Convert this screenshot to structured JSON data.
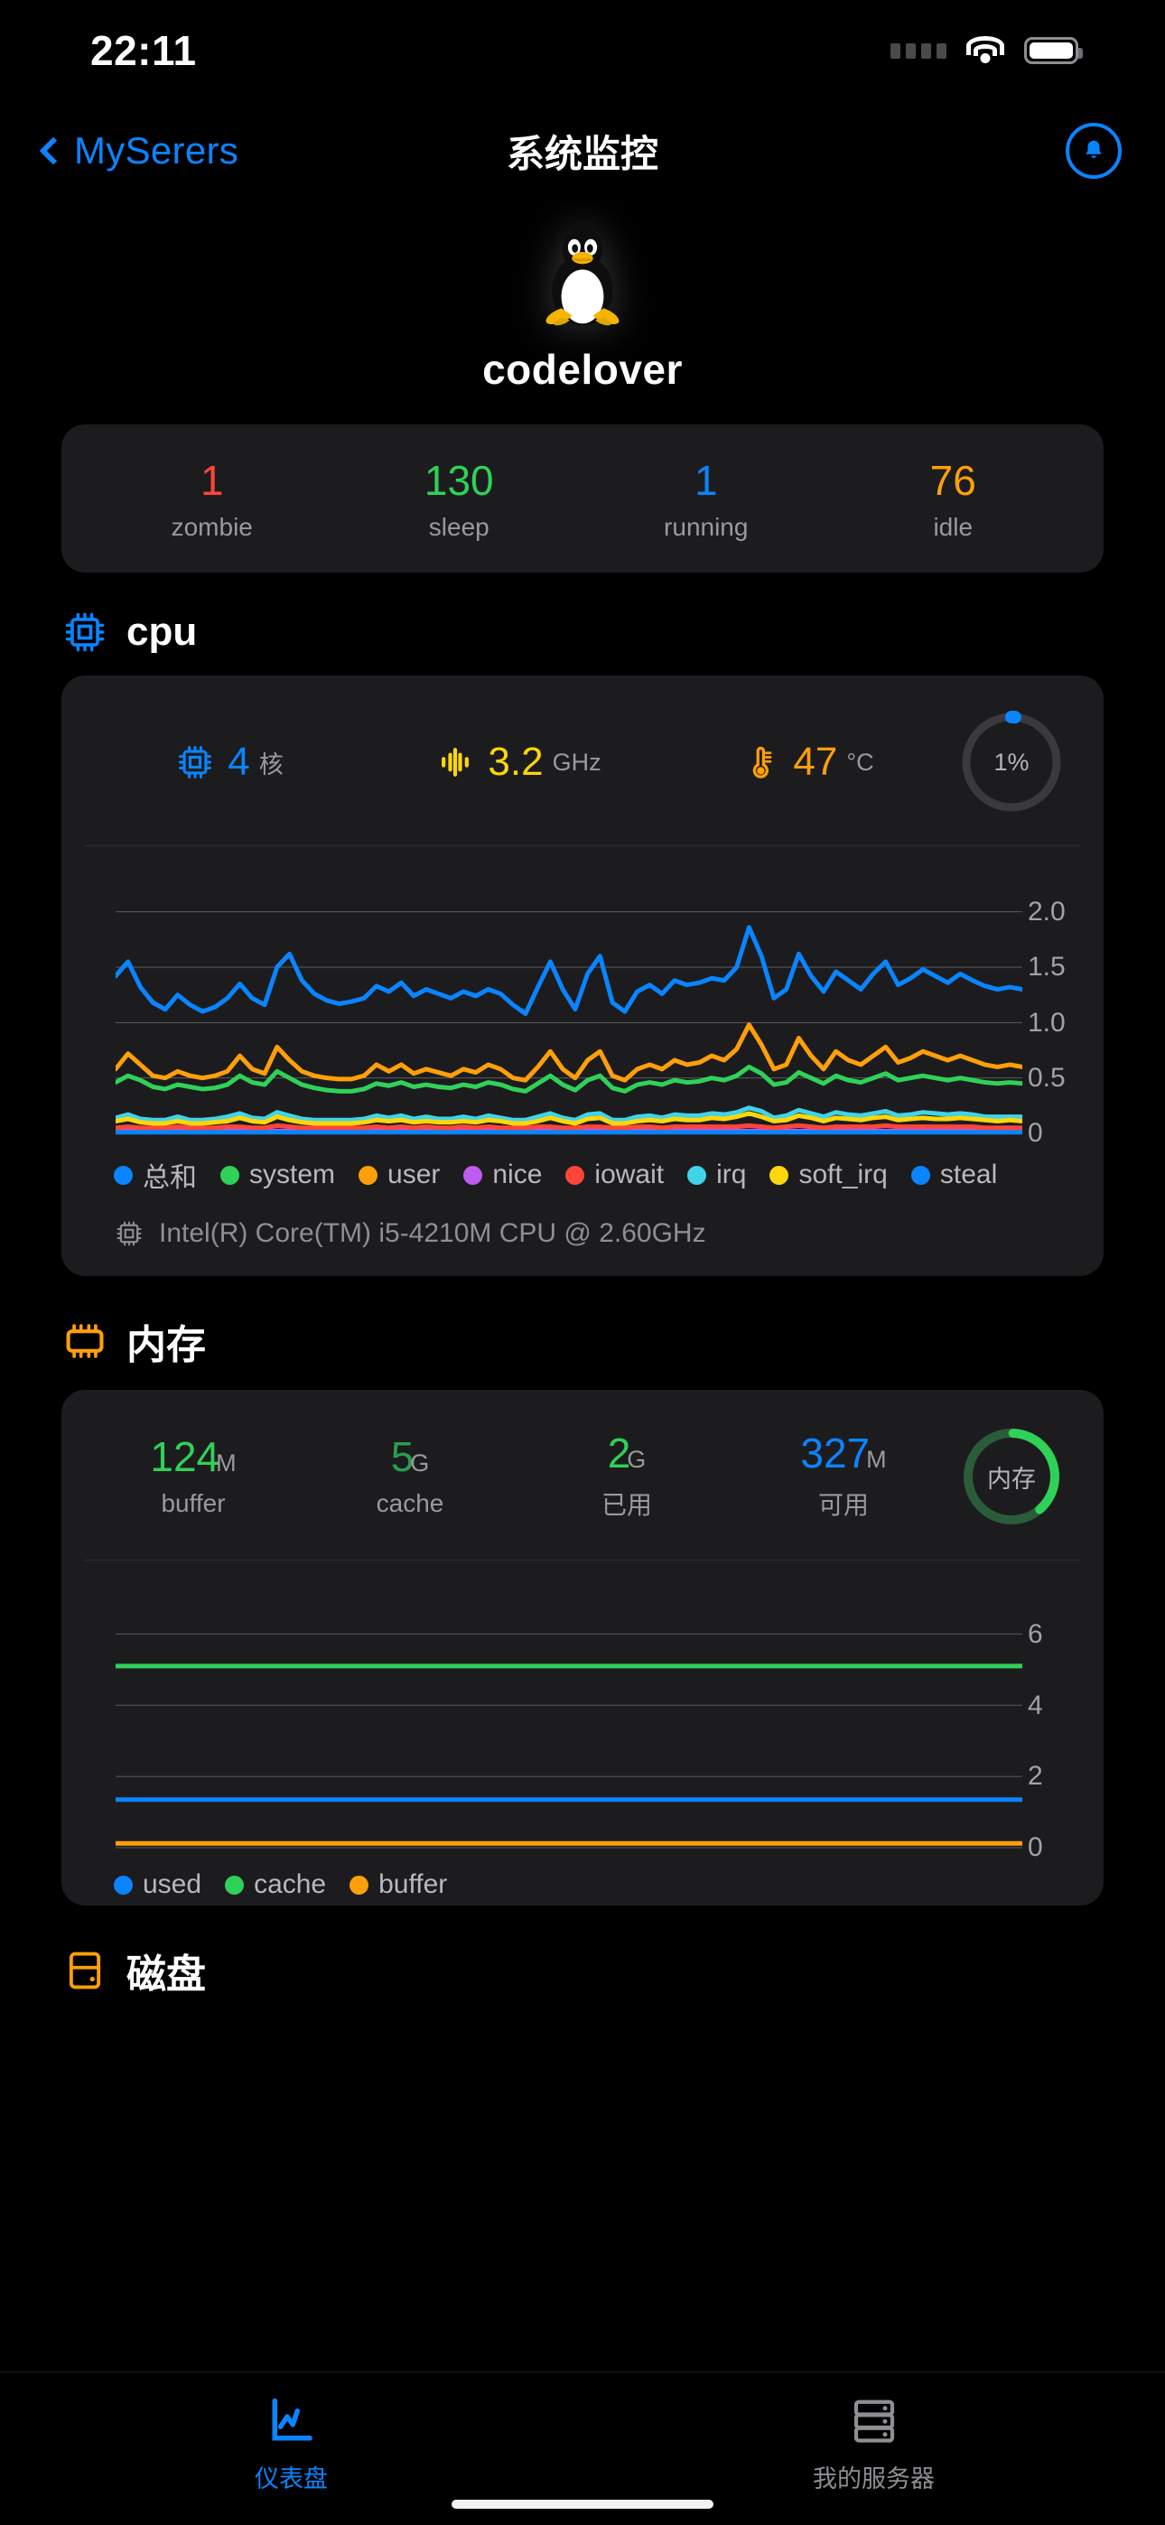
{
  "status_bar": {
    "time": "22:11",
    "icons": [
      "signal-dots-icon",
      "wifi-icon",
      "battery-icon"
    ]
  },
  "nav": {
    "back_label": "MySerers",
    "back_icon": "chevron-left-icon",
    "title": "系统监控",
    "bell_icon": "bell-icon"
  },
  "hero": {
    "logo_icon": "linux-penguin-icon",
    "hostname": "codelover"
  },
  "process_stats": [
    {
      "value": "1",
      "label": "zombie",
      "color": "#ff453a"
    },
    {
      "value": "130",
      "label": "sleep",
      "color": "#30d158"
    },
    {
      "value": "1",
      "label": "running",
      "color": "#0a84ff"
    },
    {
      "value": "76",
      "label": "idle",
      "color": "#ff9f0a"
    }
  ],
  "cpu": {
    "section_icon": "cpu-chip-icon",
    "section_title": "cpu",
    "cores": {
      "icon": "cpu-chip-icon",
      "value": "4",
      "unit": "核",
      "color": "#0a84ff"
    },
    "freq": {
      "icon": "frequency-icon",
      "value": "3.2",
      "unit": "GHz",
      "color": "#ffd60a"
    },
    "temp": {
      "icon": "thermometer-icon",
      "value": "47",
      "unit": "°C",
      "color": "#ff9f0a"
    },
    "gauge": {
      "label": "1%",
      "percent": 1,
      "color": "#0a84ff",
      "track": "#3a3a3c"
    },
    "model_icon": "cpu-chip-icon",
    "model": "Intel(R) Core(TM) i5-4210M CPU @ 2.60GHz"
  },
  "memory": {
    "section_icon": "memory-chip-icon",
    "section_title": "内存",
    "stats": [
      {
        "value": "124",
        "unit": "M",
        "label": "buffer",
        "color": "#30d158"
      },
      {
        "value": "5",
        "unit": "G",
        "label": "cache",
        "color": "#2a9d4f"
      },
      {
        "value": "2",
        "unit": "G",
        "label": "已用",
        "color": "#30d158"
      },
      {
        "value": "327",
        "unit": "M",
        "label": "可用",
        "color": "#0a84ff"
      }
    ],
    "gauge": {
      "label": "内存",
      "percent": 38,
      "color": "#30d158",
      "track": "#2b5c3a"
    }
  },
  "disk": {
    "section_icon": "disk-icon",
    "section_title": "磁盘"
  },
  "tabs": [
    {
      "label": "仪表盘",
      "icon": "dashboard-chart-icon",
      "active": true
    },
    {
      "label": "我的服务器",
      "icon": "server-rack-icon",
      "active": false
    }
  ],
  "chart_data": [
    {
      "type": "line",
      "title": "cpu",
      "xlabel": "",
      "ylabel": "",
      "ylim": [
        0,
        2.25
      ],
      "yticks": [
        "2.0",
        "1.5",
        "1.0",
        "0.5",
        "0"
      ],
      "ytick_values": [
        2.0,
        1.5,
        1.0,
        0.5,
        0
      ],
      "grid": true,
      "legend_position": "bottom",
      "series": [
        {
          "name": "总和",
          "color": "#0a84ff",
          "values": [
            1.42,
            1.55,
            1.32,
            1.18,
            1.12,
            1.25,
            1.16,
            1.1,
            1.14,
            1.22,
            1.35,
            1.22,
            1.16,
            1.5,
            1.62,
            1.38,
            1.26,
            1.2,
            1.17,
            1.19,
            1.22,
            1.33,
            1.28,
            1.36,
            1.24,
            1.3,
            1.26,
            1.22,
            1.28,
            1.24,
            1.3,
            1.26,
            1.16,
            1.08,
            1.32,
            1.55,
            1.3,
            1.12,
            1.44,
            1.6,
            1.18,
            1.1,
            1.28,
            1.34,
            1.26,
            1.38,
            1.34,
            1.36,
            1.4,
            1.38,
            1.5,
            1.86,
            1.6,
            1.22,
            1.3,
            1.62,
            1.42,
            1.28,
            1.46,
            1.38,
            1.3,
            1.44,
            1.55,
            1.34,
            1.4,
            1.48,
            1.42,
            1.36,
            1.44,
            1.38,
            1.33,
            1.3,
            1.32,
            1.3
          ]
        },
        {
          "name": "system",
          "color": "#30d158",
          "values": [
            0.46,
            0.52,
            0.48,
            0.42,
            0.4,
            0.44,
            0.42,
            0.4,
            0.41,
            0.44,
            0.52,
            0.46,
            0.44,
            0.56,
            0.5,
            0.44,
            0.41,
            0.39,
            0.38,
            0.38,
            0.4,
            0.45,
            0.43,
            0.46,
            0.42,
            0.44,
            0.42,
            0.41,
            0.44,
            0.42,
            0.46,
            0.44,
            0.4,
            0.38,
            0.45,
            0.52,
            0.44,
            0.39,
            0.48,
            0.52,
            0.41,
            0.38,
            0.44,
            0.46,
            0.44,
            0.48,
            0.46,
            0.47,
            0.5,
            0.48,
            0.52,
            0.6,
            0.54,
            0.44,
            0.46,
            0.55,
            0.5,
            0.45,
            0.52,
            0.48,
            0.46,
            0.5,
            0.54,
            0.48,
            0.5,
            0.52,
            0.5,
            0.48,
            0.5,
            0.48,
            0.46,
            0.45,
            0.46,
            0.45
          ]
        },
        {
          "name": "user",
          "color": "#ff9f0a",
          "values": [
            0.58,
            0.72,
            0.62,
            0.52,
            0.5,
            0.56,
            0.52,
            0.5,
            0.52,
            0.56,
            0.7,
            0.58,
            0.54,
            0.78,
            0.66,
            0.56,
            0.52,
            0.5,
            0.49,
            0.49,
            0.52,
            0.62,
            0.56,
            0.62,
            0.54,
            0.58,
            0.55,
            0.52,
            0.58,
            0.55,
            0.62,
            0.58,
            0.5,
            0.48,
            0.6,
            0.74,
            0.58,
            0.5,
            0.66,
            0.74,
            0.52,
            0.48,
            0.58,
            0.62,
            0.58,
            0.66,
            0.62,
            0.64,
            0.7,
            0.66,
            0.76,
            0.98,
            0.8,
            0.58,
            0.62,
            0.86,
            0.7,
            0.58,
            0.74,
            0.66,
            0.62,
            0.7,
            0.78,
            0.64,
            0.68,
            0.74,
            0.7,
            0.66,
            0.7,
            0.66,
            0.62,
            0.6,
            0.62,
            0.6
          ]
        },
        {
          "name": "nice",
          "color": "#bf5af2",
          "values": [
            0.02,
            0.02,
            0.02,
            0.02,
            0.02,
            0.02,
            0.02,
            0.02,
            0.02,
            0.02,
            0.02,
            0.02,
            0.02,
            0.02,
            0.02,
            0.02,
            0.02,
            0.02,
            0.02,
            0.02,
            0.02,
            0.02,
            0.02,
            0.02,
            0.02,
            0.02,
            0.02,
            0.02,
            0.02,
            0.02,
            0.02,
            0.02,
            0.02,
            0.02,
            0.02,
            0.02,
            0.02,
            0.02,
            0.02,
            0.02,
            0.02,
            0.02,
            0.02,
            0.02,
            0.02,
            0.02,
            0.02,
            0.02,
            0.02,
            0.02,
            0.02,
            0.02,
            0.02,
            0.02,
            0.02,
            0.02,
            0.02,
            0.02,
            0.02,
            0.02,
            0.02,
            0.02,
            0.02,
            0.02,
            0.02,
            0.02,
            0.02,
            0.02,
            0.02,
            0.02,
            0.02,
            0.02,
            0.02,
            0.02
          ]
        },
        {
          "name": "iowait",
          "color": "#ff453a",
          "values": [
            0.05,
            0.06,
            0.05,
            0.05,
            0.05,
            0.06,
            0.05,
            0.05,
            0.05,
            0.06,
            0.06,
            0.05,
            0.05,
            0.07,
            0.06,
            0.05,
            0.05,
            0.05,
            0.05,
            0.05,
            0.05,
            0.06,
            0.05,
            0.06,
            0.05,
            0.06,
            0.05,
            0.05,
            0.06,
            0.05,
            0.06,
            0.05,
            0.05,
            0.05,
            0.06,
            0.06,
            0.05,
            0.05,
            0.06,
            0.06,
            0.05,
            0.05,
            0.06,
            0.06,
            0.05,
            0.06,
            0.06,
            0.06,
            0.06,
            0.06,
            0.06,
            0.07,
            0.06,
            0.05,
            0.06,
            0.07,
            0.06,
            0.05,
            0.06,
            0.06,
            0.06,
            0.06,
            0.07,
            0.06,
            0.06,
            0.06,
            0.06,
            0.06,
            0.06,
            0.06,
            0.05,
            0.05,
            0.05,
            0.05
          ]
        },
        {
          "name": "irq",
          "color": "#40d4e8",
          "values": [
            0.14,
            0.17,
            0.13,
            0.12,
            0.12,
            0.15,
            0.12,
            0.12,
            0.13,
            0.15,
            0.18,
            0.14,
            0.13,
            0.19,
            0.16,
            0.13,
            0.12,
            0.12,
            0.12,
            0.12,
            0.13,
            0.16,
            0.14,
            0.16,
            0.13,
            0.15,
            0.13,
            0.13,
            0.15,
            0.13,
            0.16,
            0.14,
            0.12,
            0.12,
            0.15,
            0.18,
            0.14,
            0.12,
            0.17,
            0.18,
            0.12,
            0.12,
            0.15,
            0.16,
            0.14,
            0.17,
            0.16,
            0.16,
            0.18,
            0.17,
            0.19,
            0.23,
            0.2,
            0.14,
            0.16,
            0.21,
            0.18,
            0.15,
            0.19,
            0.17,
            0.16,
            0.18,
            0.2,
            0.16,
            0.17,
            0.19,
            0.18,
            0.17,
            0.18,
            0.17,
            0.15,
            0.15,
            0.15,
            0.15
          ]
        },
        {
          "name": "soft_irq",
          "color": "#ffd60a",
          "values": [
            0.11,
            0.13,
            0.1,
            0.09,
            0.09,
            0.11,
            0.09,
            0.09,
            0.1,
            0.11,
            0.14,
            0.11,
            0.1,
            0.15,
            0.12,
            0.1,
            0.09,
            0.09,
            0.09,
            0.09,
            0.1,
            0.12,
            0.11,
            0.12,
            0.1,
            0.11,
            0.1,
            0.1,
            0.11,
            0.1,
            0.12,
            0.11,
            0.09,
            0.09,
            0.11,
            0.14,
            0.11,
            0.09,
            0.13,
            0.14,
            0.09,
            0.09,
            0.11,
            0.12,
            0.11,
            0.13,
            0.12,
            0.12,
            0.14,
            0.13,
            0.15,
            0.18,
            0.15,
            0.11,
            0.12,
            0.16,
            0.14,
            0.11,
            0.14,
            0.13,
            0.12,
            0.14,
            0.15,
            0.12,
            0.13,
            0.14,
            0.13,
            0.13,
            0.14,
            0.13,
            0.12,
            0.11,
            0.12,
            0.11
          ]
        },
        {
          "name": "steal",
          "color": "#0a84ff",
          "values": [
            0.01,
            0.01,
            0.01,
            0.01,
            0.01,
            0.01,
            0.01,
            0.01,
            0.01,
            0.01,
            0.01,
            0.01,
            0.01,
            0.01,
            0.01,
            0.01,
            0.01,
            0.01,
            0.01,
            0.01,
            0.01,
            0.01,
            0.01,
            0.01,
            0.01,
            0.01,
            0.01,
            0.01,
            0.01,
            0.01,
            0.01,
            0.01,
            0.01,
            0.01,
            0.01,
            0.01,
            0.01,
            0.01,
            0.01,
            0.01,
            0.01,
            0.01,
            0.01,
            0.01,
            0.01,
            0.01,
            0.01,
            0.01,
            0.01,
            0.01,
            0.01,
            0.01,
            0.01,
            0.01,
            0.01,
            0.01,
            0.01,
            0.01,
            0.01,
            0.01,
            0.01,
            0.01,
            0.01,
            0.01,
            0.01,
            0.01,
            0.01,
            0.01,
            0.01,
            0.01,
            0.01,
            0.01,
            0.01,
            0.01
          ]
        }
      ]
    },
    {
      "type": "line",
      "title": "内存",
      "xlabel": "",
      "ylabel": "",
      "ylim": [
        0,
        7
      ],
      "yticks": [
        "6",
        "4",
        "2",
        "0"
      ],
      "ytick_values": [
        6,
        4,
        2,
        0
      ],
      "grid": true,
      "legend_position": "bottom",
      "series": [
        {
          "name": "used",
          "color": "#0a84ff",
          "constant": 1.35
        },
        {
          "name": "cache",
          "color": "#30d158",
          "constant": 5.1
        },
        {
          "name": "buffer",
          "color": "#ff9f0a",
          "constant": 0.12
        }
      ]
    }
  ]
}
